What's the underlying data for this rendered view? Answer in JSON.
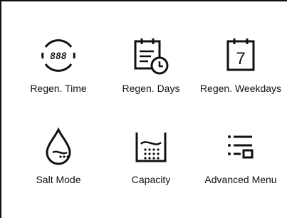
{
  "menu": {
    "items": [
      {
        "id": "regen-time",
        "label": "Regen. Time",
        "icon": "digital-clock-icon",
        "display_text": "888"
      },
      {
        "id": "regen-days",
        "label": "Regen. Days",
        "icon": "calendar-clock-icon"
      },
      {
        "id": "regen-weekdays",
        "label": "Regen. Weekdays",
        "icon": "calendar-day-icon",
        "day_number": "7"
      },
      {
        "id": "salt-mode",
        "label": "Salt Mode",
        "icon": "salt-drop-icon"
      },
      {
        "id": "capacity",
        "label": "Capacity",
        "icon": "tank-capacity-icon"
      },
      {
        "id": "advanced-menu",
        "label": "Advanced Menu",
        "icon": "list-menu-icon"
      }
    ]
  },
  "colors": {
    "foreground": "#111111",
    "background": "#ffffff"
  }
}
